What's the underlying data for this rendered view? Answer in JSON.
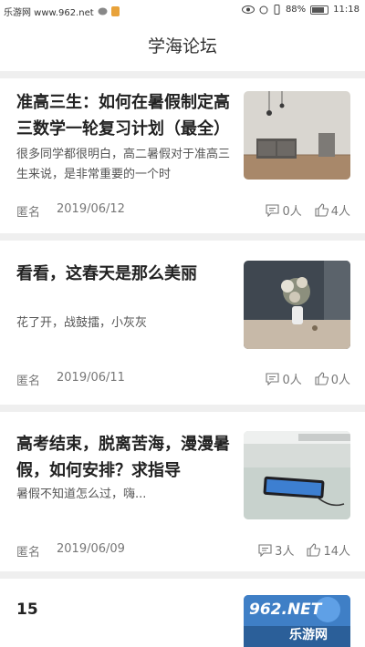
{
  "statusbar": {
    "watermark_left": "乐游网 www.962.net",
    "battery": "88%",
    "time": "11:18"
  },
  "header": {
    "title": "学海论坛"
  },
  "posts": [
    {
      "title": "准高三生：如何在暑假制定高三数学一轮复习计划（最全）",
      "summary": "很多同学都很明白，高二暑假对于准高三生来说，是非常重要的一个时",
      "author": "匿名",
      "date": "2019/06/12",
      "comments": "0人",
      "likes": "4人",
      "image": "room-with-cabinet"
    },
    {
      "title": "看看，这春天是那么美丽",
      "summary": "花了开，战鼓擂，小灰灰",
      "author": "匿名",
      "date": "2019/06/11",
      "comments": "0人",
      "likes": "0人",
      "image": "flower-vase-on-table"
    },
    {
      "title": "高考结束，脱离苦海，漫漫暑假，如何安排？求指导",
      "summary": "暑假不知道怎么过，嗨...",
      "author": "匿名",
      "date": "2019/06/09",
      "comments": "3人",
      "likes": "14人",
      "image": "phone-on-desk"
    }
  ],
  "partial_post": {
    "number": "15"
  },
  "watermark_br": {
    "line1": "962.NET",
    "line2": "乐游网"
  }
}
